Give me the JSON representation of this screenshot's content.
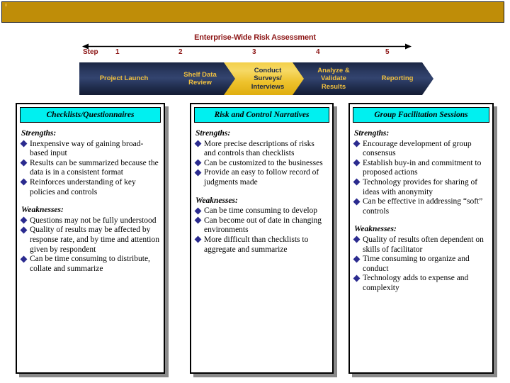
{
  "banner": {
    "color": "#bf8d08"
  },
  "timeline": {
    "title": "Enterprise-Wide Risk Assessment",
    "title_color": "#8c1515",
    "step_word": "Step",
    "step_numbers": [
      "1",
      "2",
      "3",
      "4",
      "5"
    ]
  },
  "process": {
    "highlight_step_index": 2,
    "dark_color": "#22305a",
    "dark_text_color": "#f0c040",
    "gold_color": "#eec22c",
    "gold_text_color": "#1b2744",
    "steps": [
      {
        "label": "Project Launch",
        "highlighted": false
      },
      {
        "label": "Shelf Data\nReview",
        "highlighted": false
      },
      {
        "label": "Conduct\nSurveys/\nInterviews",
        "highlighted": true
      },
      {
        "label": "Analyze &\nValidate\nResults",
        "highlighted": false
      },
      {
        "label": "Reporting",
        "highlighted": false
      }
    ]
  },
  "panels": {
    "header_bg": "#00f0f0",
    "bullet_color": "#2b2b8f",
    "strengths_label": "Strengths:",
    "weaknesses_label": "Weaknesses:",
    "items": [
      {
        "title": "Checklists/Questionnaires",
        "strengths": [
          "Inexpensive way of gaining broad-based input",
          "Results can be summarized because the data is in a consistent format",
          "Reinforces understanding of key policies and controls"
        ],
        "weaknesses": [
          "Questions may not be fully understood",
          "Quality of results may be affected by response rate, and by time and attention given by respondent",
          "Can be time consuming to distribute, collate and summarize"
        ]
      },
      {
        "title": "Risk and Control Narratives",
        "strengths": [
          "More precise descriptions of risks and controls than checklists",
          "Can be customized to the businesses",
          "Provide an easy to follow record of judgments made"
        ],
        "weaknesses": [
          "Can be time consuming to develop",
          "Can become out of date in changing environments",
          "More difficult than checklists to aggregate and summarize"
        ]
      },
      {
        "title": "Group Facilitation Sessions",
        "strengths": [
          "Encourage development of group consensus",
          "Establish buy-in and commitment to proposed actions",
          "Technology provides for sharing of ideas with anonymity",
          "Can be effective in addressing “soft” controls"
        ],
        "weaknesses": [
          "Quality of results often dependent on skills of facilitator",
          "Time consuming to organize and conduct",
          "Technology adds to expense and complexity"
        ]
      }
    ]
  }
}
